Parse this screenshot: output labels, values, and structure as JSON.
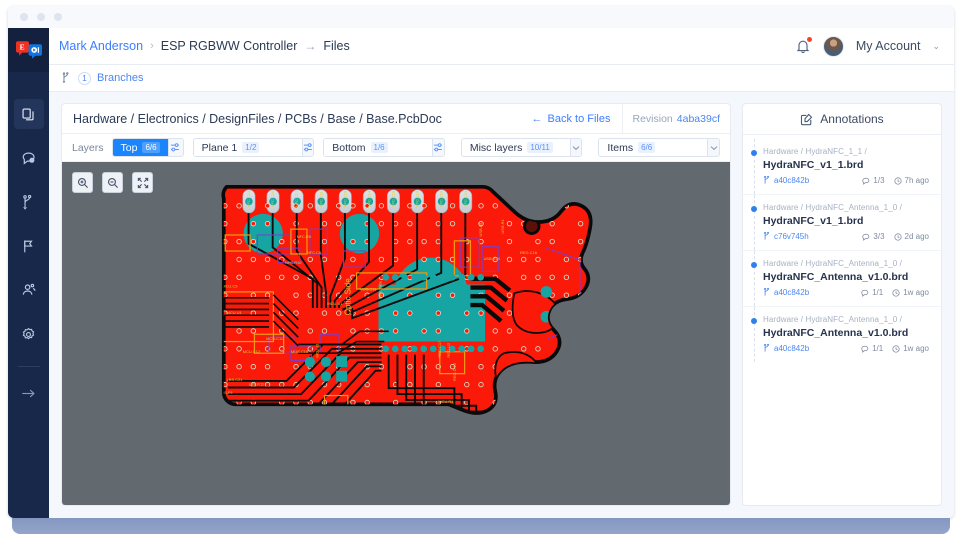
{
  "window": {
    "dots": 3
  },
  "sidebar": {
    "logo_name": "altium-365-logo",
    "items": [
      {
        "name": "files",
        "icon": "copy-files-icon",
        "active": true
      },
      {
        "name": "comments",
        "icon": "comment-icon",
        "active": false
      },
      {
        "name": "branches",
        "icon": "branch-icon",
        "active": false
      },
      {
        "name": "releases",
        "icon": "flag-icon",
        "active": false
      },
      {
        "name": "team",
        "icon": "users-icon",
        "active": false
      },
      {
        "name": "settings",
        "icon": "gear-icon",
        "active": false
      },
      {
        "name": "collapse",
        "icon": "arrow-right-icon",
        "active": false
      }
    ]
  },
  "header": {
    "breadcrumb": [
      {
        "label": "Mark Anderson",
        "link": true,
        "sep": "›"
      },
      {
        "label": "ESP RGBWW Controller",
        "link": false,
        "sep": "→"
      },
      {
        "label": "Files",
        "link": false,
        "sep": ""
      }
    ],
    "account_label": "My Account",
    "account_caret": "⌄",
    "bell_icon": "bell-icon",
    "has_notification": true
  },
  "subbar": {
    "branch_icon": "branch-icon",
    "branch_count": "1",
    "branch_label": "Branches"
  },
  "viewer": {
    "file_path": "Hardware / Electronics / DesignFiles / PCBs / Base / Base.PcbDoc",
    "back_label": "Back to Files",
    "back_arrow": "←",
    "revision_label": "Revision",
    "revision_hash": "4aba39cf",
    "layers_label": "Layers",
    "layer_groups": [
      {
        "name": "top",
        "label": "Top",
        "badge": "6/6",
        "active": true,
        "trailing": "sliders-icon"
      },
      {
        "name": "plane1",
        "label": "Plane 1",
        "badge": "1/2",
        "active": false,
        "trailing": "sliders-icon"
      },
      {
        "name": "bottom",
        "label": "Bottom",
        "badge": "1/6",
        "active": false,
        "trailing": "sliders-icon"
      },
      {
        "name": "misc",
        "label": "Misc layers",
        "badge": "10/11",
        "active": false,
        "trailing": "caret-down-icon"
      },
      {
        "name": "items",
        "label": "Items",
        "badge": "6/6",
        "active": false,
        "trailing": "caret-down-icon"
      }
    ],
    "zoom_tools": [
      {
        "name": "zoom-in",
        "icon": "zoom-in-icon"
      },
      {
        "name": "zoom-out",
        "icon": "zoom-out-icon"
      },
      {
        "name": "fit-screen",
        "icon": "fit-screen-icon"
      }
    ],
    "canvas_bg": "#62696f",
    "pcb": {
      "board_color": "#fb1909",
      "pad_color": "#17a5a3",
      "silk_color": "#d8d13a",
      "outline_color": "#000000",
      "designators": [
        "NFC.C13",
        "NFC.C16",
        "NFC.C17",
        "NFC.C11",
        "NFC.C18",
        "NFC.C14",
        "NFC.C15",
        "NFC.C12",
        "NFC.C19",
        "NFC.C41",
        "NFC.R8",
        "NFC.C8",
        "NFC.R10",
        "MCU.C5",
        "MCU.U1",
        "MCU.C12",
        "MCU.C11",
        "MCU.U1",
        "MOS.C11",
        "MOS.C18",
        "MCU.J1",
        "LBS.C21",
        "LBS.R1",
        "LBS.R11",
        "LBS.SW2",
        "LBS.SW1",
        "MCU.D1",
        "MCU.U1",
        "MCU.J1",
        "USB.H1",
        "USB.R1",
        "USB.R14",
        "REG.C16",
        "REG.C17",
        "REG.U2",
        "REG.D.15",
        "MCU.R1",
        "Optic Side"
      ]
    }
  },
  "annotations": {
    "title": "Annotations",
    "icon": "annotate-edit-icon",
    "items": [
      {
        "path": "Hardware / HydraNFC_1_1 /",
        "file": "HydraNFC_v1_1.brd",
        "hash": "a40c842b",
        "comments": "1/3",
        "time": "7h ago"
      },
      {
        "path": "Hardware / HydraNFC_Antenna_1_0 /",
        "file": "HydraNFC_v1_1.brd",
        "hash": "c76v745h",
        "comments": "3/3",
        "time": "2d ago"
      },
      {
        "path": "Hardware / HydraNFC_Antenna_1_0 /",
        "file": "HydraNFC_Antenna_v1.0.brd",
        "hash": "a40c842b",
        "comments": "1/1",
        "time": "1w ago"
      },
      {
        "path": "Hardware / HydraNFC_Antenna_1_0 /",
        "file": "HydraNFC_Antenna_v1.0.brd",
        "hash": "a40c842b",
        "comments": "1/1",
        "time": "1w ago"
      }
    ]
  },
  "colors": {
    "accent": "#1a85fc",
    "link": "#3d7eff",
    "rail_bg": "#18284b",
    "canvas": "#62696f"
  }
}
